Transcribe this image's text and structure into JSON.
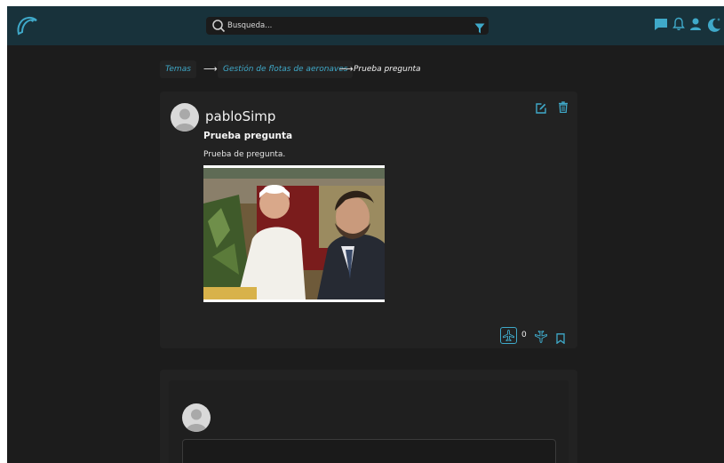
{
  "search": {
    "placeholder": "Busqueda..."
  },
  "breadcrumb": {
    "items": [
      "Temas",
      "Gestión de flotas de aeronaves"
    ],
    "current": "Prueba pregunta",
    "separator": "⟶"
  },
  "question": {
    "username": "pabloSimp",
    "title": "Prueba pregunta",
    "body": "Prueba de pregunta.",
    "votes": "0"
  },
  "colors": {
    "accent": "#3fa9c9",
    "topbar": "#18323b",
    "background": "#1c1c1c",
    "card": "#222222"
  },
  "icons": {
    "logo": "dolphin-logo-icon",
    "search": "search-icon",
    "filter": "filter-icon",
    "chat": "chat-icon",
    "notifications": "bell-icon",
    "profile": "user-icon",
    "theme": "moon-icon",
    "edit": "edit-icon",
    "delete": "trash-icon",
    "upvote": "plane-up-icon",
    "downvote": "plane-down-icon",
    "bookmark": "bookmark-icon"
  }
}
